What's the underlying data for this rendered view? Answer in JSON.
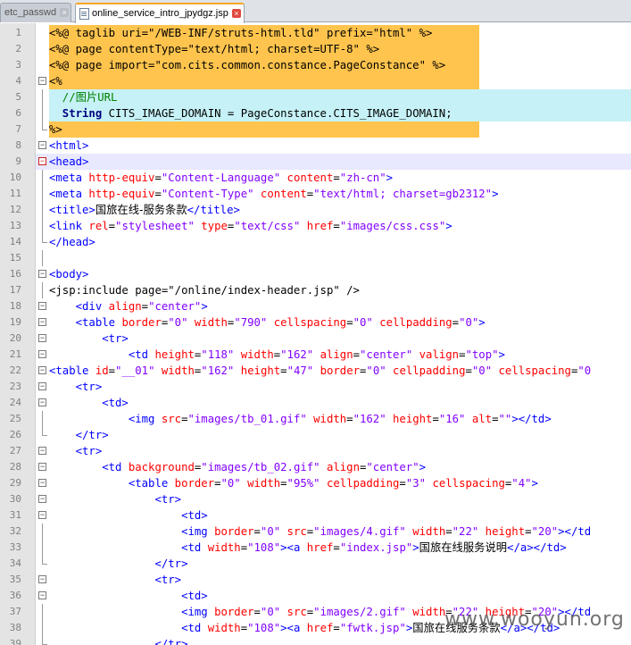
{
  "tabs": [
    {
      "label": "etc_passwd",
      "active": false
    },
    {
      "label": "online_service_intro_jpydgz.jsp",
      "active": true
    }
  ],
  "lines": [
    {
      "n": "1",
      "hl": "orange",
      "fold": "",
      "segs": [
        [
          "p",
          "<%@ "
        ],
        [
          "p",
          "taglib uri=\"/WEB-INF/struts-html.tld\" prefix=\"html\" "
        ],
        [
          "p",
          "%>"
        ]
      ]
    },
    {
      "n": "2",
      "hl": "orange",
      "fold": "",
      "segs": [
        [
          "p",
          "<%@ page contentType=\"text/html; charset=UTF-8\" %>"
        ]
      ]
    },
    {
      "n": "3",
      "hl": "orange",
      "fold": "",
      "segs": [
        [
          "p",
          "<%@ page import=\"com.cits.common.constance.PageConstance\" %>"
        ]
      ]
    },
    {
      "n": "4",
      "hl": "orange",
      "fold": "minus",
      "segs": [
        [
          "p",
          "<%"
        ]
      ]
    },
    {
      "n": "5",
      "hl": "cyan",
      "fold": "bar",
      "segs": [
        [
          "c",
          "  //图片URL"
        ]
      ]
    },
    {
      "n": "6",
      "hl": "cyan",
      "fold": "bar",
      "segs": [
        [
          "k",
          "  String"
        ],
        [
          "p",
          " CITS_IMAGE_DOMAIN = PageConstance.CITS_IMAGE_DOMAIN;"
        ]
      ]
    },
    {
      "n": "7",
      "hl": "orange",
      "fold": "end",
      "segs": [
        [
          "p",
          "%>"
        ]
      ]
    },
    {
      "n": "8",
      "hl": "",
      "fold": "minus",
      "segs": [
        [
          "t",
          "<html>"
        ]
      ]
    },
    {
      "n": "9",
      "hl": "cur",
      "fold": "redminus",
      "segs": [
        [
          "t",
          "<head>"
        ]
      ]
    },
    {
      "n": "10",
      "hl": "",
      "fold": "bar",
      "segs": [
        [
          "t",
          "<meta "
        ],
        [
          "a",
          "http-equiv"
        ],
        [
          "p",
          "="
        ],
        [
          "s",
          "\"Content-Language\""
        ],
        [
          "a",
          " content"
        ],
        [
          "p",
          "="
        ],
        [
          "s",
          "\"zh-cn\""
        ],
        [
          "t",
          ">"
        ]
      ]
    },
    {
      "n": "11",
      "hl": "",
      "fold": "bar",
      "segs": [
        [
          "t",
          "<meta "
        ],
        [
          "a",
          "http-equiv"
        ],
        [
          "p",
          "="
        ],
        [
          "s",
          "\"Content-Type\""
        ],
        [
          "a",
          " content"
        ],
        [
          "p",
          "="
        ],
        [
          "s",
          "\"text/html; charset=gb2312\""
        ],
        [
          "t",
          ">"
        ]
      ]
    },
    {
      "n": "12",
      "hl": "",
      "fold": "bar",
      "segs": [
        [
          "t",
          "<title>"
        ],
        [
          "cn",
          "国旅在线-服务条款"
        ],
        [
          "t",
          "</title>"
        ]
      ]
    },
    {
      "n": "13",
      "hl": "",
      "fold": "bar",
      "segs": [
        [
          "t",
          "<link "
        ],
        [
          "a",
          "rel"
        ],
        [
          "p",
          "="
        ],
        [
          "s",
          "\"stylesheet\""
        ],
        [
          "a",
          " type"
        ],
        [
          "p",
          "="
        ],
        [
          "s",
          "\"text/css\""
        ],
        [
          "a",
          " href"
        ],
        [
          "p",
          "="
        ],
        [
          "s",
          "\"images/css.css\""
        ],
        [
          "t",
          ">"
        ]
      ]
    },
    {
      "n": "14",
      "hl": "",
      "fold": "end",
      "segs": [
        [
          "t",
          "</head>"
        ]
      ]
    },
    {
      "n": "15",
      "hl": "",
      "fold": "bar",
      "segs": []
    },
    {
      "n": "16",
      "hl": "",
      "fold": "minus",
      "segs": [
        [
          "t",
          "<body>"
        ]
      ]
    },
    {
      "n": "17",
      "hl": "",
      "fold": "bar",
      "segs": [
        [
          "p",
          "<jsp:include page=\"/online/index-header.jsp\" />"
        ]
      ]
    },
    {
      "n": "18",
      "hl": "",
      "fold": "minus",
      "segs": [
        [
          "t",
          "    <div "
        ],
        [
          "a",
          "align"
        ],
        [
          "p",
          "="
        ],
        [
          "s",
          "\"center\""
        ],
        [
          "t",
          ">"
        ]
      ]
    },
    {
      "n": "19",
      "hl": "",
      "fold": "minus",
      "segs": [
        [
          "t",
          "    <table "
        ],
        [
          "a",
          "border"
        ],
        [
          "p",
          "="
        ],
        [
          "s",
          "\"0\""
        ],
        [
          "a",
          " width"
        ],
        [
          "p",
          "="
        ],
        [
          "s",
          "\"790\""
        ],
        [
          "a",
          " cellspacing"
        ],
        [
          "p",
          "="
        ],
        [
          "s",
          "\"0\""
        ],
        [
          "a",
          " cellpadding"
        ],
        [
          "p",
          "="
        ],
        [
          "s",
          "\"0\""
        ],
        [
          "t",
          ">"
        ]
      ]
    },
    {
      "n": "20",
      "hl": "",
      "fold": "minus",
      "segs": [
        [
          "t",
          "        <tr>"
        ]
      ]
    },
    {
      "n": "21",
      "hl": "",
      "fold": "minus",
      "segs": [
        [
          "t",
          "            <td "
        ],
        [
          "a",
          "height"
        ],
        [
          "p",
          "="
        ],
        [
          "s",
          "\"118\""
        ],
        [
          "a",
          " width"
        ],
        [
          "p",
          "="
        ],
        [
          "s",
          "\"162\""
        ],
        [
          "a",
          " align"
        ],
        [
          "p",
          "="
        ],
        [
          "s",
          "\"center\""
        ],
        [
          "a",
          " valign"
        ],
        [
          "p",
          "="
        ],
        [
          "s",
          "\"top\""
        ],
        [
          "t",
          ">"
        ]
      ]
    },
    {
      "n": "22",
      "hl": "",
      "fold": "minus",
      "segs": [
        [
          "t",
          "<table "
        ],
        [
          "a",
          "id"
        ],
        [
          "p",
          "="
        ],
        [
          "s",
          "\"__01\""
        ],
        [
          "a",
          " width"
        ],
        [
          "p",
          "="
        ],
        [
          "s",
          "\"162\""
        ],
        [
          "a",
          " height"
        ],
        [
          "p",
          "="
        ],
        [
          "s",
          "\"47\""
        ],
        [
          "a",
          " border"
        ],
        [
          "p",
          "="
        ],
        [
          "s",
          "\"0\""
        ],
        [
          "a",
          " cellpadding"
        ],
        [
          "p",
          "="
        ],
        [
          "s",
          "\"0\""
        ],
        [
          "a",
          " cellspacing"
        ],
        [
          "p",
          "="
        ],
        [
          "s",
          "\"0"
        ]
      ]
    },
    {
      "n": "23",
      "hl": "",
      "fold": "minus",
      "segs": [
        [
          "t",
          "    <tr>"
        ]
      ]
    },
    {
      "n": "24",
      "hl": "",
      "fold": "minus",
      "segs": [
        [
          "t",
          "        <td>"
        ]
      ]
    },
    {
      "n": "25",
      "hl": "",
      "fold": "bar",
      "segs": [
        [
          "t",
          "            <img "
        ],
        [
          "a",
          "src"
        ],
        [
          "p",
          "="
        ],
        [
          "s",
          "\"images/tb_01.gif\""
        ],
        [
          "a",
          " width"
        ],
        [
          "p",
          "="
        ],
        [
          "s",
          "\"162\""
        ],
        [
          "a",
          " height"
        ],
        [
          "p",
          "="
        ],
        [
          "s",
          "\"16\""
        ],
        [
          "a",
          " alt"
        ],
        [
          "p",
          "="
        ],
        [
          "s",
          "\"\""
        ],
        [
          "t",
          "></td>"
        ]
      ]
    },
    {
      "n": "26",
      "hl": "",
      "fold": "end",
      "segs": [
        [
          "t",
          "    </tr>"
        ]
      ]
    },
    {
      "n": "27",
      "hl": "",
      "fold": "minus",
      "segs": [
        [
          "t",
          "    <tr>"
        ]
      ]
    },
    {
      "n": "28",
      "hl": "",
      "fold": "minus",
      "segs": [
        [
          "t",
          "        <td "
        ],
        [
          "a",
          "background"
        ],
        [
          "p",
          "="
        ],
        [
          "s",
          "\"images/tb_02.gif\""
        ],
        [
          "a",
          " align"
        ],
        [
          "p",
          "="
        ],
        [
          "s",
          "\"center\""
        ],
        [
          "t",
          ">"
        ]
      ]
    },
    {
      "n": "29",
      "hl": "",
      "fold": "minus",
      "segs": [
        [
          "t",
          "            <table "
        ],
        [
          "a",
          "border"
        ],
        [
          "p",
          "="
        ],
        [
          "s",
          "\"0\""
        ],
        [
          "a",
          " width"
        ],
        [
          "p",
          "="
        ],
        [
          "s",
          "\"95%\""
        ],
        [
          "a",
          " cellpadding"
        ],
        [
          "p",
          "="
        ],
        [
          "s",
          "\"3\""
        ],
        [
          "a",
          " cellspacing"
        ],
        [
          "p",
          "="
        ],
        [
          "s",
          "\"4\""
        ],
        [
          "t",
          ">"
        ]
      ]
    },
    {
      "n": "30",
      "hl": "",
      "fold": "minus",
      "segs": [
        [
          "t",
          "                <tr>"
        ]
      ]
    },
    {
      "n": "31",
      "hl": "",
      "fold": "minus",
      "segs": [
        [
          "t",
          "                    <td>"
        ]
      ]
    },
    {
      "n": "32",
      "hl": "",
      "fold": "bar",
      "segs": [
        [
          "t",
          "                    <img "
        ],
        [
          "a",
          "border"
        ],
        [
          "p",
          "="
        ],
        [
          "s",
          "\"0\""
        ],
        [
          "a",
          " src"
        ],
        [
          "p",
          "="
        ],
        [
          "s",
          "\"images/4.gif\""
        ],
        [
          "a",
          " width"
        ],
        [
          "p",
          "="
        ],
        [
          "s",
          "\"22\""
        ],
        [
          "a",
          " height"
        ],
        [
          "p",
          "="
        ],
        [
          "s",
          "\"20\""
        ],
        [
          "t",
          "></td"
        ]
      ]
    },
    {
      "n": "33",
      "hl": "",
      "fold": "bar",
      "segs": [
        [
          "t",
          "                    <td "
        ],
        [
          "a",
          "width"
        ],
        [
          "p",
          "="
        ],
        [
          "s",
          "\"108\""
        ],
        [
          "t",
          "><a "
        ],
        [
          "a",
          "href"
        ],
        [
          "p",
          "="
        ],
        [
          "s",
          "\"index.jsp\""
        ],
        [
          "t",
          ">"
        ],
        [
          "cn",
          "国旅在线服务说明"
        ],
        [
          "t",
          "</a></td>"
        ]
      ]
    },
    {
      "n": "34",
      "hl": "",
      "fold": "end",
      "segs": [
        [
          "t",
          "                </tr>"
        ]
      ]
    },
    {
      "n": "35",
      "hl": "",
      "fold": "minus",
      "segs": [
        [
          "t",
          "                <tr>"
        ]
      ]
    },
    {
      "n": "36",
      "hl": "",
      "fold": "minus",
      "segs": [
        [
          "t",
          "                    <td>"
        ]
      ]
    },
    {
      "n": "37",
      "hl": "",
      "fold": "bar",
      "segs": [
        [
          "t",
          "                    <img "
        ],
        [
          "a",
          "border"
        ],
        [
          "p",
          "="
        ],
        [
          "s",
          "\"0\""
        ],
        [
          "a",
          " src"
        ],
        [
          "p",
          "="
        ],
        [
          "s",
          "\"images/2.gif\""
        ],
        [
          "a",
          " width"
        ],
        [
          "p",
          "="
        ],
        [
          "s",
          "\"22\""
        ],
        [
          "a",
          " height"
        ],
        [
          "p",
          "="
        ],
        [
          "s",
          "\"20\""
        ],
        [
          "t",
          "></td"
        ]
      ]
    },
    {
      "n": "38",
      "hl": "",
      "fold": "bar",
      "segs": [
        [
          "t",
          "                    <td "
        ],
        [
          "a",
          "width"
        ],
        [
          "p",
          "="
        ],
        [
          "s",
          "\"108\""
        ],
        [
          "t",
          "><a "
        ],
        [
          "a",
          "href"
        ],
        [
          "p",
          "="
        ],
        [
          "s",
          "\"fwtk.jsp\""
        ],
        [
          "t",
          ">"
        ],
        [
          "cn",
          "国旅在线服务条款"
        ],
        [
          "t",
          "</a></td>"
        ]
      ]
    },
    {
      "n": "39",
      "hl": "",
      "fold": "end",
      "segs": [
        [
          "t",
          "                </tr>"
        ]
      ]
    }
  ],
  "watermark": "www.wooyun.org",
  "colors": {
    "tag": "#0000ff",
    "attr": "#ff0000",
    "string": "#8000ff",
    "comment": "#008000",
    "keyword": "#00007f",
    "highlight_orange": "#ffc44d",
    "highlight_cyan": "#c6f2f7"
  }
}
